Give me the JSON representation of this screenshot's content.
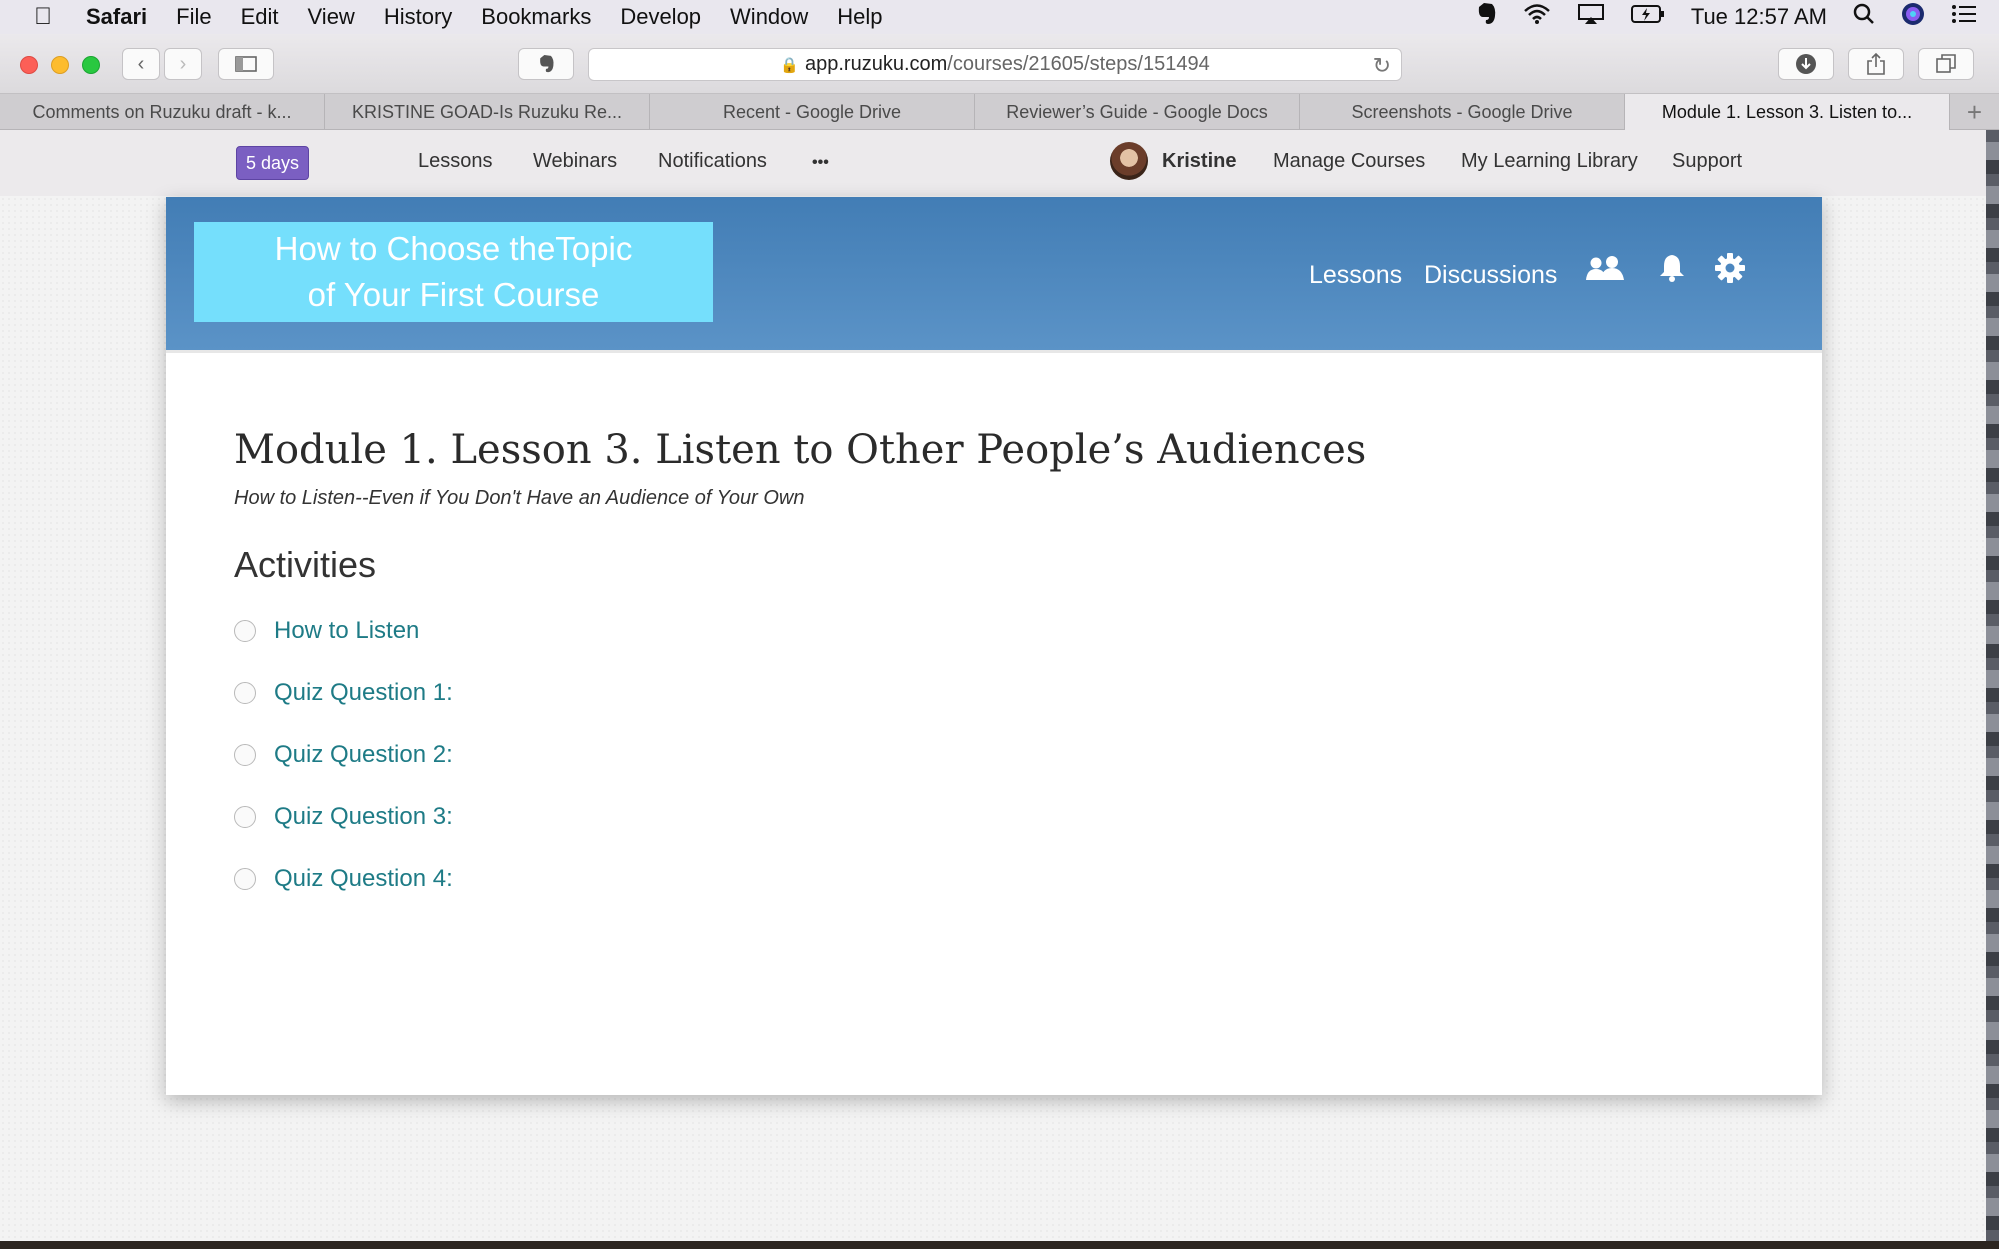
{
  "menubar": {
    "app": "Safari",
    "items": [
      "File",
      "Edit",
      "View",
      "History",
      "Bookmarks",
      "Develop",
      "Window",
      "Help"
    ],
    "clock": "Tue 12:57 AM"
  },
  "browser": {
    "url_domain": "app.ruzuku.com",
    "url_path": "/courses/21605/steps/151494",
    "tabs": [
      "Comments on Ruzuku draft - k...",
      "KRISTINE GOAD-Is Ruzuku Re...",
      "Recent - Google Drive",
      "Reviewer’s Guide - Google Docs",
      "Screenshots - Google Drive",
      "Module 1. Lesson 3. Listen to..."
    ]
  },
  "appnav": {
    "trial_badge": "5 days",
    "links": [
      "Lessons",
      "Webinars",
      "Notifications"
    ],
    "more": "•••",
    "user": "Kristine",
    "right_links": [
      "Manage Courses",
      "My Learning Library",
      "Support"
    ]
  },
  "course": {
    "logo_line1": "How to Choose theTopic",
    "logo_line2": "of Your First Course",
    "nav_lessons": "Lessons",
    "nav_discussions": "Discussions"
  },
  "lesson": {
    "title": "Module 1. Lesson 3. Listen to Other People’s Audiences",
    "subtitle": "How to Listen--Even if You Don't Have an Audience of Your Own",
    "activities_heading": "Activities",
    "activities": [
      "How to Listen",
      "Quiz Question 1:",
      "Quiz Question 2:",
      "Quiz Question 3:",
      "Quiz Question 4:"
    ]
  }
}
